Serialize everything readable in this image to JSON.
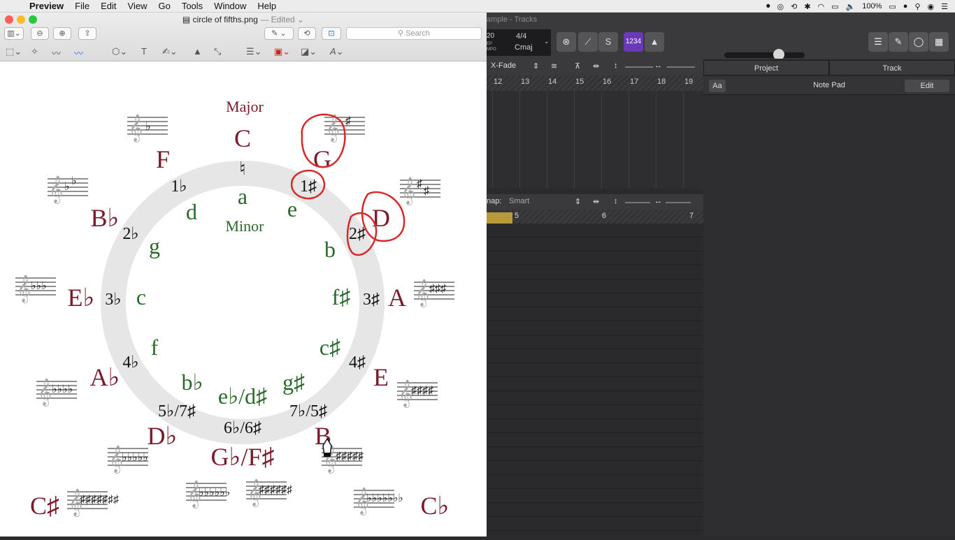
{
  "menubar": {
    "app_name": "Preview",
    "items": [
      "File",
      "Edit",
      "View",
      "Go",
      "Tools",
      "Window",
      "Help"
    ],
    "battery": "100%"
  },
  "preview": {
    "filename": "circle of fifths.png",
    "edited": "— Edited",
    "search_placeholder": "Search",
    "diagram": {
      "major_label": "Major",
      "minor_label": "Minor",
      "center_top": "C",
      "center_natural": "♮",
      "center_minor": "a",
      "majors": [
        {
          "name": "C"
        },
        {
          "name": "G"
        },
        {
          "name": "D"
        },
        {
          "name": "A"
        },
        {
          "name": "E"
        },
        {
          "name": "B"
        },
        {
          "name": "G♭/F♯"
        },
        {
          "name": "D♭"
        },
        {
          "name": "A♭"
        },
        {
          "name": "E♭"
        },
        {
          "name": "B♭"
        },
        {
          "name": "F"
        },
        {
          "name": "C♯"
        },
        {
          "name": "C♭"
        }
      ],
      "minors": [
        "e",
        "b",
        "f♯",
        "c♯",
        "g♯",
        "e♭/d♯",
        "b♭",
        "f",
        "c",
        "g",
        "d"
      ],
      "counts": [
        "1♯",
        "2♯",
        "3♯",
        "4♯",
        "7♭/5♯",
        "6♭/6♯",
        "5♭/7♯",
        "4♭",
        "3♭",
        "2♭",
        "1♭"
      ]
    }
  },
  "logic": {
    "window_title": "ample - Tracks",
    "lcd": {
      "bar": "20",
      "tempo_label": "EP",
      "tempo_label2": "MPO",
      "signature": "4/4",
      "key": "Cmaj"
    },
    "count_in": "1234",
    "xfade": "X-Fade",
    "ruler_numbers": [
      "12",
      "13",
      "14",
      "15",
      "16",
      "17",
      "18",
      "19"
    ],
    "snap_label": "nap:",
    "snap_value": "Smart",
    "pr_ruler": [
      "5",
      "6",
      "7"
    ],
    "inspector": {
      "tab_project": "Project",
      "tab_track": "Track",
      "aa": "Aa",
      "notepad": "Note Pad",
      "edit": "Edit"
    }
  },
  "colors": {
    "major": "#7a1a2a",
    "minor": "#2a6a2a",
    "annotation": "#d62a2a",
    "ring": "#e4e4e4"
  }
}
